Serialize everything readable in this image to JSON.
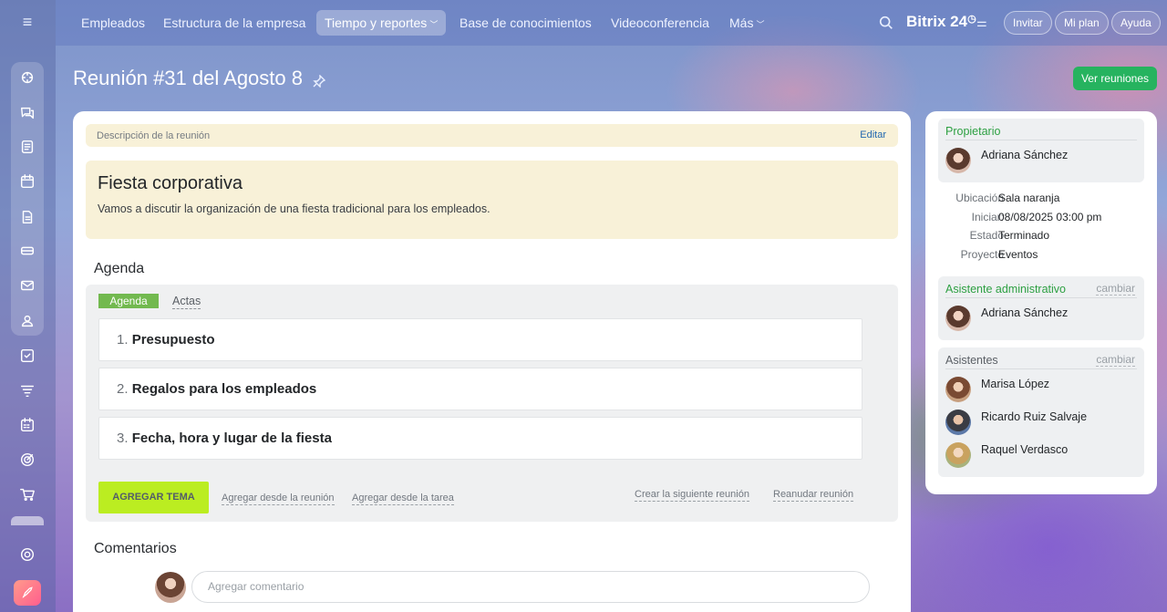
{
  "topnav": {
    "items": [
      {
        "label": "Empleados"
      },
      {
        "label": "Estructura de la empresa"
      },
      {
        "label": "Tiempo y reportes"
      },
      {
        "label": "Base de conocimientos"
      },
      {
        "label": "Videoconferencia"
      },
      {
        "label": "Más"
      }
    ],
    "brand": "Bitrix 24",
    "buttons": {
      "invite": "Invitar",
      "plan": "Mi plan",
      "help": "Ayuda"
    }
  },
  "sidebar": {
    "icons": [
      "activity-icon",
      "chat-icon",
      "feed-icon",
      "calendar-icon",
      "document-icon",
      "drive-icon",
      "mail-icon",
      "groups-icon",
      "tasks-icon",
      "crm-funnel-icon",
      "planner-icon",
      "target-icon",
      "cart-icon",
      "settings-icon",
      "rocket-icon"
    ]
  },
  "page": {
    "title": "Reunión #31 del Agosto 8",
    "view_meetings": "Ver reuniones"
  },
  "description": {
    "label": "Descripción de la reunión",
    "edit": "Editar",
    "title": "Fiesta corporativa",
    "text": "Vamos a discutir la organización de una fiesta tradicional para los empleados."
  },
  "agenda": {
    "section_title": "Agenda",
    "tabs": {
      "agenda": "Agenda",
      "actas": "Actas"
    },
    "items": [
      {
        "num": "1.",
        "name": "Presupuesto"
      },
      {
        "num": "2.",
        "name": "Regalos para los empleados"
      },
      {
        "num": "3.",
        "name": "Fecha, hora y lugar de la fiesta"
      }
    ],
    "add_topic": "AGREGAR TEMA",
    "add_from_meeting": "Agregar desde la reunión",
    "add_from_task": "Agregar desde la tarea",
    "create_next": "Crear la siguiente reunión",
    "resume": "Reanudar reunión"
  },
  "comments": {
    "section_title": "Comentarios",
    "placeholder": "Agregar comentario"
  },
  "details": {
    "owner_label": "Propietario",
    "owner_name": "Adriana Sánchez",
    "location_label": "Ubicación",
    "location_value": "Sala naranja",
    "start_label": "Iniciar:",
    "start_value": "08/08/2025 03:00 pm",
    "status_label": "Estado",
    "status_value": "Terminado",
    "project_label": "Proyecto",
    "project_value": "Eventos",
    "assistant_label": "Asistente administrativo",
    "assistant_change": "cambiar",
    "assistant_name": "Adriana Sánchez",
    "attendees_label": "Asistentes",
    "attendees_change": "cambiar",
    "attendees": [
      {
        "name": "Marisa López"
      },
      {
        "name": "Ricardo Ruiz Salvaje"
      },
      {
        "name": "Raquel Verdasco"
      }
    ]
  },
  "colors": {
    "accent_green": "#26b35f",
    "add_topic_lime": "#bbed21",
    "tab_active": "#72b94f",
    "desc_background": "#f8f1d8"
  }
}
